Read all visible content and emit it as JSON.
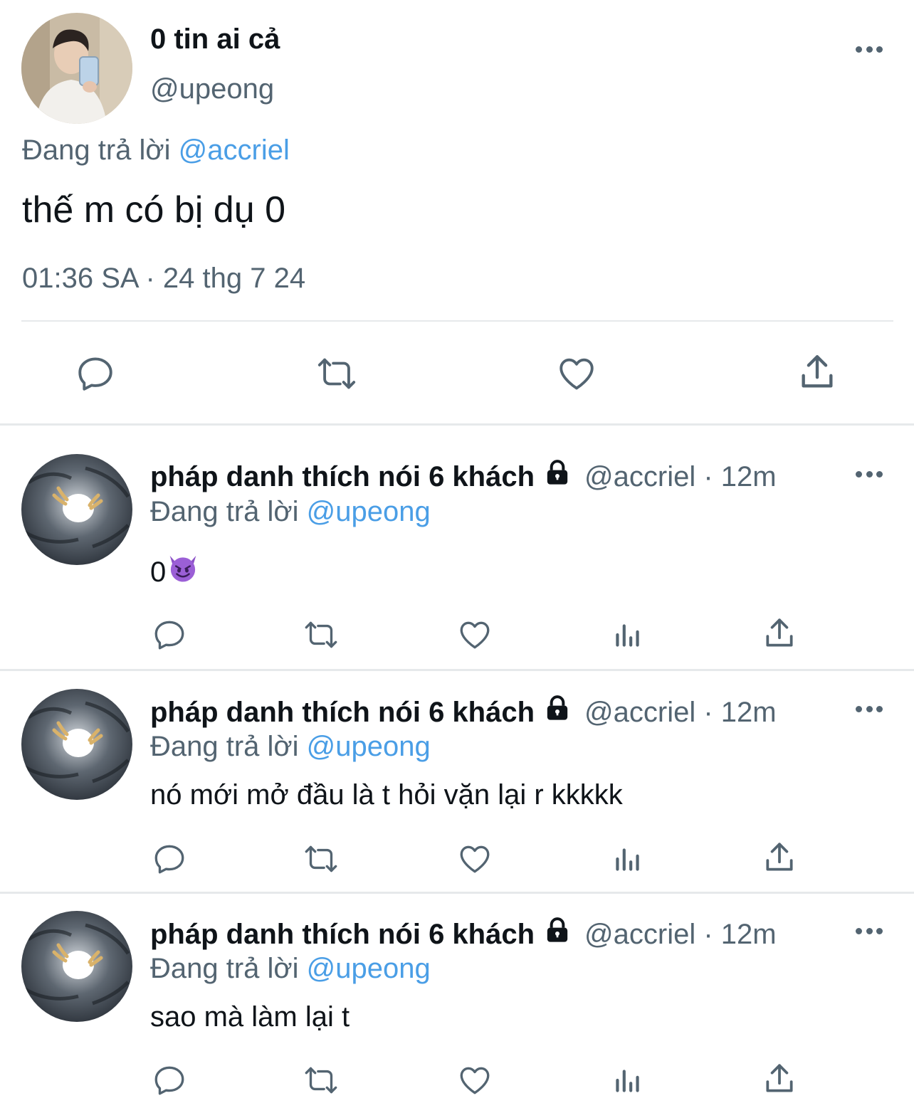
{
  "main_tweet": {
    "display_name": "0 tin ai cả",
    "handle": "@upeong",
    "replying_prefix": "Đang trả lời",
    "replying_to": "@accriel",
    "text": "thế m có bị dụ 0",
    "timestamp": "01:36 SA · 24 thg 7 24",
    "actions": [
      "reply-icon",
      "retweet-icon",
      "like-icon",
      "share-icon"
    ]
  },
  "replies": [
    {
      "display_name": "pháp danh thích nói 6 khách",
      "handle_time": "@accriel · 12m",
      "replying_prefix": "Đang trả lời",
      "replying_to": "@upeong",
      "text": "0",
      "emoji": "smiling-imp-emoji"
    },
    {
      "display_name": "pháp danh thích nói 6 khách",
      "handle_time": "@accriel · 12m",
      "replying_prefix": "Đang trả lời",
      "replying_to": "@upeong",
      "text": "nó mới mở đầu là t hỏi vặn lại r kkkkk"
    },
    {
      "display_name": "pháp danh thích nói 6 khách",
      "handle_time": "@accriel · 12m",
      "replying_prefix": "Đang trả lời",
      "replying_to": "@upeong",
      "text": "sao mà làm lại t"
    }
  ],
  "reply_actions": [
    "reply-icon",
    "retweet-icon",
    "like-icon",
    "views-icon",
    "share-icon"
  ],
  "colors": {
    "text": "#0f1419",
    "secondary": "#536471",
    "link": "#4a9ee6",
    "divider": "#e6e9eb"
  }
}
